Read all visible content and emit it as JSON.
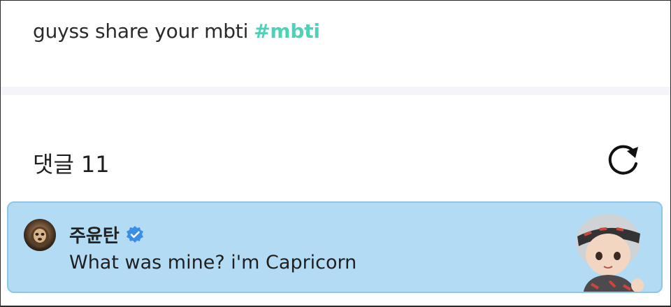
{
  "post": {
    "text": "guyss share your mbti",
    "hashtag": "#mbti"
  },
  "comments_section": {
    "label": "댓글",
    "count": "11",
    "refresh_icon": "refresh-icon"
  },
  "comment": {
    "author": "주윤탄",
    "verified_icon": "verified-badge-icon",
    "text": "What was mine? i'm Capricorn",
    "avatar_icon": "avatar",
    "sticker_icon": "chibi-character-sticker",
    "card_color": "#b3dcf4",
    "border_color": "#8dc6e6"
  },
  "colors": {
    "hashtag": "#4fd1b8",
    "verified": "#3b8ee8"
  }
}
